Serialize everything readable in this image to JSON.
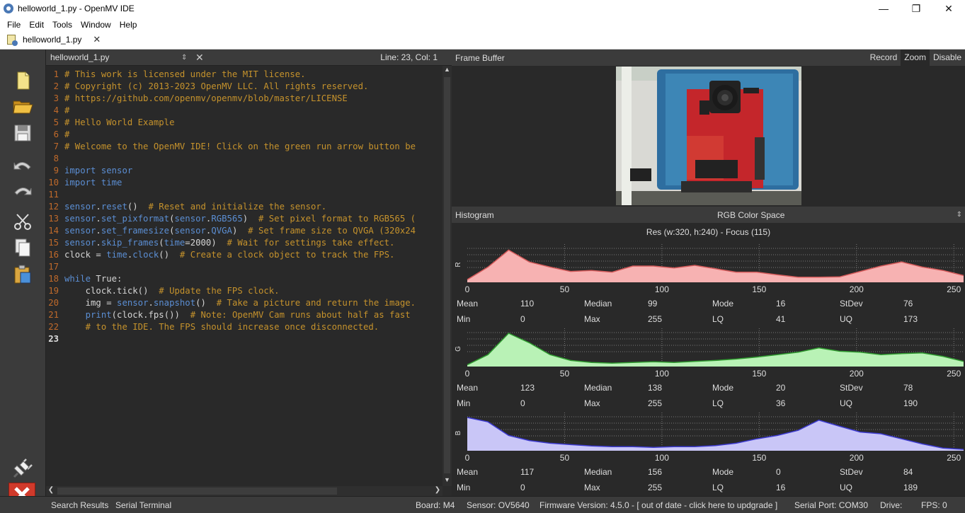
{
  "window": {
    "title": "helloworld_1.py - OpenMV IDE",
    "minimize": "—",
    "maximize": "❐",
    "close": "✕"
  },
  "menu": [
    "File",
    "Edit",
    "Tools",
    "Window",
    "Help"
  ],
  "doc_tab": {
    "label": "helloworld_1.py",
    "close": "✕"
  },
  "editor": {
    "filename": "helloworld_1.py",
    "arrows": "⇕",
    "close": "✕",
    "cursor_pos": "Line: 23, Col: 1",
    "current_line": 23
  },
  "frame_buffer": {
    "title": "Frame Buffer",
    "buttons": [
      "Record",
      "Zoom",
      "Disable"
    ],
    "active_button": "Zoom"
  },
  "histogram": {
    "title": "Histogram",
    "color_space": "RGB Color Space",
    "resolution": "Res (w:320, h:240) - Focus (115)",
    "axis_ticks": [
      "0",
      "50",
      "100",
      "150",
      "200",
      "250"
    ],
    "stat_labels": [
      "Mean",
      "Median",
      "Mode",
      "StDev",
      "Min",
      "Max",
      "LQ",
      "UQ"
    ],
    "channels": [
      {
        "label": "R",
        "color": "#f7b2b2",
        "line": "#d45a5a",
        "mean": "110",
        "median": "99",
        "mode": "16",
        "stdev": "76",
        "min": "0",
        "max": "255",
        "lq": "41",
        "uq": "173",
        "profile": [
          0.08,
          0.45,
          0.95,
          0.6,
          0.45,
          0.32,
          0.35,
          0.3,
          0.48,
          0.48,
          0.42,
          0.5,
          0.4,
          0.3,
          0.3,
          0.22,
          0.15,
          0.15,
          0.16,
          0.32,
          0.48,
          0.6,
          0.45,
          0.35,
          0.2
        ]
      },
      {
        "label": "G",
        "color": "#b9f2b6",
        "line": "#2f9a2f",
        "mean": "123",
        "median": "138",
        "mode": "20",
        "stdev": "78",
        "min": "0",
        "max": "255",
        "lq": "36",
        "uq": "190",
        "profile": [
          0.05,
          0.35,
          0.98,
          0.7,
          0.35,
          0.18,
          0.12,
          0.1,
          0.12,
          0.14,
          0.12,
          0.15,
          0.18,
          0.22,
          0.28,
          0.35,
          0.42,
          0.55,
          0.45,
          0.42,
          0.35,
          0.38,
          0.4,
          0.3,
          0.15
        ]
      },
      {
        "label": "B",
        "color": "#c9c6f7",
        "line": "#3c3ad0",
        "mean": "117",
        "median": "156",
        "mode": "0",
        "stdev": "84",
        "min": "0",
        "max": "255",
        "lq": "16",
        "uq": "189",
        "profile": [
          0.98,
          0.85,
          0.45,
          0.3,
          0.22,
          0.18,
          0.14,
          0.12,
          0.12,
          0.1,
          0.12,
          0.12,
          0.15,
          0.22,
          0.35,
          0.45,
          0.6,
          0.9,
          0.72,
          0.55,
          0.5,
          0.35,
          0.2,
          0.08,
          0.04
        ]
      }
    ]
  },
  "status": {
    "search_results": "Search Results",
    "serial_terminal": "Serial Terminal",
    "board": "Board: M4",
    "sensor": "Sensor: OV5640",
    "firmware": "Firmware Version: 4.5.0 - [ out of date - click here to updgrade ]",
    "serial_port": "Serial Port: COM30",
    "drive": "Drive:",
    "fps": "FPS: 0"
  },
  "code": [
    [
      [
        "c",
        "# This work is licensed under the MIT license."
      ]
    ],
    [
      [
        "c",
        "# Copyright (c) 2013-2023 OpenMV LLC. All rights reserved."
      ]
    ],
    [
      [
        "c",
        "# https://github.com/openmv/openmv/blob/master/LICENSE"
      ]
    ],
    [
      [
        "c",
        "#"
      ]
    ],
    [
      [
        "c",
        "# Hello World Example"
      ]
    ],
    [
      [
        "c",
        "#"
      ]
    ],
    [
      [
        "c",
        "# Welcome to the OpenMV IDE! Click on the green run arrow button be"
      ]
    ],
    [],
    [
      [
        "kw",
        "import"
      ],
      [
        "id",
        " "
      ],
      [
        "kw",
        "sensor"
      ]
    ],
    [
      [
        "kw",
        "import"
      ],
      [
        "id",
        " "
      ],
      [
        "kw",
        "time"
      ]
    ],
    [],
    [
      [
        "kw",
        "sensor"
      ],
      [
        "id",
        "."
      ],
      [
        "kw",
        "reset"
      ],
      [
        "id",
        "()  "
      ],
      [
        "c",
        "# Reset and initialize the sensor."
      ]
    ],
    [
      [
        "kw",
        "sensor"
      ],
      [
        "id",
        "."
      ],
      [
        "kw",
        "set_pixformat"
      ],
      [
        "id",
        "("
      ],
      [
        "kw",
        "sensor"
      ],
      [
        "id",
        "."
      ],
      [
        "kw",
        "RGB565"
      ],
      [
        "id",
        ")  "
      ],
      [
        "c",
        "# Set pixel format to RGB565 ("
      ]
    ],
    [
      [
        "kw",
        "sensor"
      ],
      [
        "id",
        "."
      ],
      [
        "kw",
        "set_framesize"
      ],
      [
        "id",
        "("
      ],
      [
        "kw",
        "sensor"
      ],
      [
        "id",
        "."
      ],
      [
        "kw",
        "QVGA"
      ],
      [
        "id",
        ")  "
      ],
      [
        "c",
        "# Set frame size to QVGA (320x24"
      ]
    ],
    [
      [
        "kw",
        "sensor"
      ],
      [
        "id",
        "."
      ],
      [
        "kw",
        "skip_frames"
      ],
      [
        "id",
        "("
      ],
      [
        "kw",
        "time"
      ],
      [
        "id",
        "=2000)  "
      ],
      [
        "c",
        "# Wait for settings take effect."
      ]
    ],
    [
      [
        "id",
        "clock = "
      ],
      [
        "kw",
        "time"
      ],
      [
        "id",
        "."
      ],
      [
        "kw",
        "clock"
      ],
      [
        "id",
        "()  "
      ],
      [
        "c",
        "# Create a clock object to track the FPS."
      ]
    ],
    [],
    [
      [
        "kw",
        "while"
      ],
      [
        "id",
        " True:"
      ]
    ],
    [
      [
        "id",
        "    clock."
      ],
      [
        "id",
        "tick()  "
      ],
      [
        "c",
        "# Update the FPS clock."
      ]
    ],
    [
      [
        "id",
        "    img = "
      ],
      [
        "kw",
        "sensor"
      ],
      [
        "id",
        "."
      ],
      [
        "kw",
        "snapshot"
      ],
      [
        "id",
        "()  "
      ],
      [
        "c",
        "# Take a picture and return the image."
      ]
    ],
    [
      [
        "id",
        "    "
      ],
      [
        "kw",
        "print"
      ],
      [
        "id",
        "(clock.fps())  "
      ],
      [
        "c",
        "# Note: OpenMV Cam runs about half as fast"
      ]
    ],
    [
      [
        "id",
        "    "
      ],
      [
        "c",
        "# to the IDE. The FPS should increase once disconnected."
      ]
    ],
    []
  ]
}
